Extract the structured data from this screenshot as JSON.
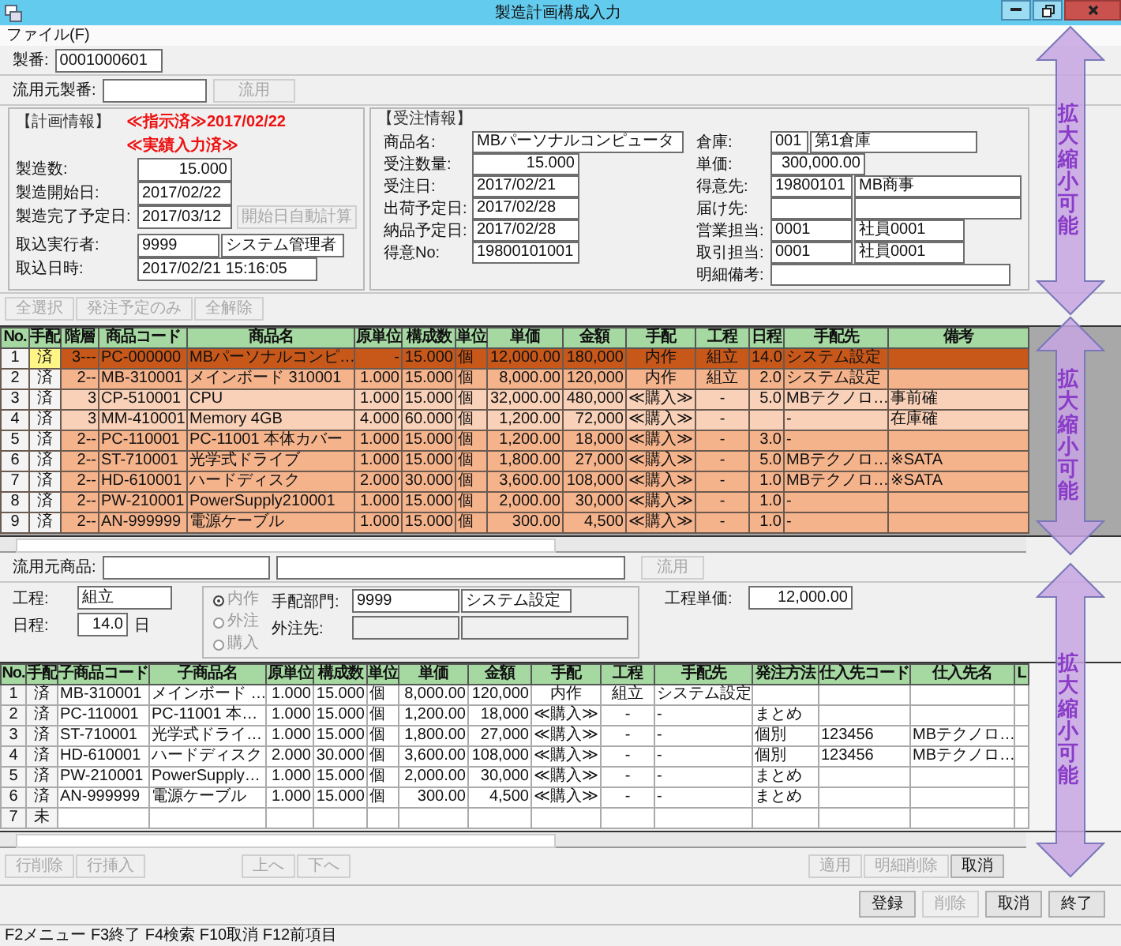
{
  "window": {
    "title": "製造計画構成入力"
  },
  "menu": [
    "ファイル(F)"
  ],
  "seiban": {
    "label": "製番:",
    "value": "0001000601"
  },
  "source_seiban": {
    "label": "流用元製番:",
    "button": {
      "label": "流用",
      "disabled": true
    }
  },
  "plan_info": {
    "title": "【計画情報】",
    "status_lines": [
      "≪指示済≫2017/02/22",
      "≪実績入力済≫"
    ],
    "fields": [
      {
        "label": "製造数:",
        "kind": "number",
        "values": [
          "15.000"
        ]
      },
      {
        "label": "製造開始日:",
        "kind": "text",
        "values": [
          "2017/02/22"
        ]
      },
      {
        "label": "製造完了予定日:",
        "kind": "text",
        "values": [
          "2017/03/12"
        ],
        "button": {
          "label": "開始日自動計算",
          "disabled": true
        }
      },
      {
        "label": "取込実行者:",
        "kind": "pair",
        "values": [
          "9999",
          "システム管理者"
        ]
      },
      {
        "label": "取込日時:",
        "kind": "wide",
        "values": [
          "2017/02/21 15:16:05"
        ]
      }
    ]
  },
  "order_info": {
    "title": "【受注情報】",
    "left": [
      {
        "label": "商品名:",
        "kind": "wide",
        "values": [
          "MBパーソナルコンピュータ"
        ]
      },
      {
        "label": "受注数量:",
        "kind": "number",
        "values": [
          "15.000"
        ]
      },
      {
        "label": "受注日:",
        "kind": "text",
        "values": [
          "2017/02/21"
        ]
      },
      {
        "label": "出荷予定日:",
        "kind": "text",
        "values": [
          "2017/02/28"
        ]
      },
      {
        "label": "納品予定日:",
        "kind": "text",
        "values": [
          "2017/02/28"
        ]
      },
      {
        "label": "得意No:",
        "kind": "text",
        "values": [
          "19800101001"
        ]
      }
    ],
    "right": [
      {
        "label": "倉庫:",
        "kind": "code",
        "values": [
          "001",
          "第1倉庫"
        ]
      },
      {
        "label": "単価:",
        "kind": "number",
        "values": [
          "300,000.00"
        ]
      },
      {
        "label": "得意先:",
        "kind": "pairwide",
        "values": [
          "19800101",
          "MB商事"
        ]
      },
      {
        "label": "届け先:",
        "kind": "pairwide"
      },
      {
        "label": "営業担当:",
        "kind": "pair",
        "values": [
          "0001",
          "社員0001"
        ]
      },
      {
        "label": "取引担当:",
        "kind": "pair",
        "values": [
          "0001",
          "社員0001"
        ]
      },
      {
        "label": "明細備考:",
        "kind": "wide"
      }
    ]
  },
  "selection_buttons": [
    {
      "label": "全選択",
      "disabled": true
    },
    {
      "label": "発注予定のみ",
      "disabled": true
    },
    {
      "label": "全解除",
      "disabled": true
    }
  ],
  "structure_table": {
    "columns": [
      {
        "label": "No.",
        "kind": "center"
      },
      {
        "label": "手配",
        "kind": "center"
      },
      {
        "label": "階層",
        "kind": "num"
      },
      {
        "label": "商品コード",
        "kind": "text"
      },
      {
        "label": "商品名",
        "kind": "text"
      },
      {
        "label": "原単位",
        "kind": "num"
      },
      {
        "label": "構成数",
        "kind": "num"
      },
      {
        "label": "単位",
        "kind": "text"
      },
      {
        "label": "単価",
        "kind": "num"
      },
      {
        "label": "金額",
        "kind": "num"
      },
      {
        "label": "手配",
        "kind": "center"
      },
      {
        "label": "工程",
        "kind": "center"
      },
      {
        "label": "日程",
        "kind": "num"
      },
      {
        "label": "手配先",
        "kind": "text"
      },
      {
        "label": "備考",
        "kind": "text"
      }
    ],
    "rows": [
      {
        "selected": true,
        "color": "#c8581a",
        "cells": [
          "1",
          "済",
          "3---",
          "PC-000000",
          "MBパーソナルコンピ…",
          "-",
          "15.000",
          "個",
          "12,000.00",
          "180,000",
          "内作",
          "組立",
          "14.0",
          "システム設定",
          null
        ]
      },
      {
        "selected": false,
        "color": "#f5b38c",
        "cells": [
          "2",
          "済",
          "2--",
          "MB-310001",
          "メインボード 310001",
          "1.000",
          "15.000",
          "個",
          "8,000.00",
          "120,000",
          "内作",
          "組立",
          "2.0",
          "システム設定",
          null
        ]
      },
      {
        "selected": false,
        "color": "#f9d1b8",
        "cells": [
          "3",
          "済",
          "3",
          "CP-510001",
          "CPU",
          "1.000",
          "15.000",
          "個",
          "32,000.00",
          "480,000",
          "≪購入≫",
          "-",
          "5.0",
          "MBテクノロ…",
          "事前確"
        ]
      },
      {
        "selected": false,
        "color": "#f9d1b8",
        "cells": [
          "4",
          "済",
          "3",
          "MM-410001",
          "Memory 4GB",
          "4.000",
          "60.000",
          "個",
          "1,200.00",
          "72,000",
          "≪購入≫",
          "-",
          null,
          "-",
          "在庫確"
        ]
      },
      {
        "selected": false,
        "color": "#f5b38c",
        "cells": [
          "5",
          "済",
          "2--",
          "PC-110001",
          "PC-11001 本体カバー",
          "1.000",
          "15.000",
          "個",
          "1,200.00",
          "18,000",
          "≪購入≫",
          "-",
          "3.0",
          "-",
          null
        ]
      },
      {
        "selected": false,
        "color": "#f5b38c",
        "cells": [
          "6",
          "済",
          "2--",
          "ST-710001",
          "光学式ドライブ",
          "1.000",
          "15.000",
          "個",
          "1,800.00",
          "27,000",
          "≪購入≫",
          "-",
          "5.0",
          "MBテクノロ…",
          "※SATA"
        ]
      },
      {
        "selected": false,
        "color": "#f5b38c",
        "cells": [
          "7",
          "済",
          "2--",
          "HD-610001",
          "ハードディスク",
          "2.000",
          "30.000",
          "個",
          "3,600.00",
          "108,000",
          "≪購入≫",
          "-",
          "1.0",
          "MBテクノロ…",
          "※SATA"
        ]
      },
      {
        "selected": false,
        "color": "#f5b38c",
        "cells": [
          "8",
          "済",
          "2--",
          "PW-210001",
          "PowerSupply210001",
          "1.000",
          "15.000",
          "個",
          "2,000.00",
          "30,000",
          "≪購入≫",
          "-",
          "1.0",
          "-",
          null
        ]
      },
      {
        "selected": false,
        "color": "#f5b38c",
        "cells": [
          "9",
          "済",
          "2--",
          "AN-999999",
          "電源ケーブル",
          "1.000",
          "15.000",
          "個",
          "300.00",
          "4,500",
          "≪購入≫",
          "-",
          "1.0",
          "-",
          null
        ]
      }
    ]
  },
  "process_panel": {
    "source_item": {
      "label": "流用元商品:",
      "button": {
        "label": "流用",
        "disabled": true
      }
    },
    "process": {
      "label": "工程:",
      "value": "組立"
    },
    "schedule": {
      "label": "日程:",
      "value": "14.0",
      "unit": "日"
    },
    "arrangement": {
      "disabled": true,
      "options": [
        {
          "label": "内作",
          "selected": true
        },
        {
          "label": "外注",
          "selected": false
        },
        {
          "label": "購入",
          "selected": false
        }
      ]
    },
    "department": {
      "label": "手配部門:",
      "values": [
        "9999",
        "システム設定"
      ]
    },
    "subcontractor": {
      "label": "外注先:"
    },
    "process_price": {
      "label": "工程単価:",
      "value": "12,000.00"
    }
  },
  "components_table": {
    "columns": [
      {
        "label": "No.",
        "kind": "center"
      },
      {
        "label": "手配",
        "kind": "center"
      },
      {
        "label": "子商品コード",
        "kind": "text"
      },
      {
        "label": "子商品名",
        "kind": "text"
      },
      {
        "label": "原単位",
        "kind": "num"
      },
      {
        "label": "構成数",
        "kind": "num"
      },
      {
        "label": "単位",
        "kind": "text"
      },
      {
        "label": "単価",
        "kind": "num"
      },
      {
        "label": "金額",
        "kind": "num"
      },
      {
        "label": "手配",
        "kind": "center"
      },
      {
        "label": "工程",
        "kind": "center"
      },
      {
        "label": "手配先",
        "kind": "text"
      },
      {
        "label": "発注方法",
        "kind": "text"
      },
      {
        "label": "仕入先コード",
        "kind": "text"
      },
      {
        "label": "仕入先名",
        "kind": "text"
      },
      {
        "label": "L",
        "kind": "text"
      }
    ],
    "rows": [
      {
        "cells": [
          "1",
          "済",
          "MB-310001",
          "メインボード …",
          "1.000",
          "15.000",
          "個",
          "8,000.00",
          "120,000",
          "内作",
          "組立",
          "システム設定",
          null,
          null,
          null,
          null
        ]
      },
      {
        "cells": [
          "2",
          "済",
          "PC-110001",
          "PC-11001 本…",
          "1.000",
          "15.000",
          "個",
          "1,200.00",
          "18,000",
          "≪購入≫",
          "-",
          "-",
          "まとめ",
          null,
          null,
          null
        ]
      },
      {
        "cells": [
          "3",
          "済",
          "ST-710001",
          "光学式ドライ…",
          "1.000",
          "15.000",
          "個",
          "1,800.00",
          "27,000",
          "≪購入≫",
          "-",
          "-",
          "個別",
          "123456",
          "MBテクノロ…",
          null
        ]
      },
      {
        "cells": [
          "4",
          "済",
          "HD-610001",
          "ハードディスク",
          "2.000",
          "30.000",
          "個",
          "3,600.00",
          "108,000",
          "≪購入≫",
          "-",
          "-",
          "個別",
          "123456",
          "MBテクノロ…",
          null
        ]
      },
      {
        "cells": [
          "5",
          "済",
          "PW-210001",
          "PowerSupply…",
          "1.000",
          "15.000",
          "個",
          "2,000.00",
          "30,000",
          "≪購入≫",
          "-",
          "-",
          "まとめ",
          null,
          null,
          null
        ]
      },
      {
        "cells": [
          "6",
          "済",
          "AN-999999",
          "電源ケーブル",
          "1.000",
          "15.000",
          "個",
          "300.00",
          "4,500",
          "≪購入≫",
          "-",
          "-",
          "まとめ",
          null,
          null,
          null
        ]
      },
      {
        "cells": [
          "7",
          "未",
          null,
          null,
          null,
          null,
          null,
          null,
          null,
          null,
          null,
          null,
          null,
          null,
          null,
          null
        ]
      }
    ]
  },
  "row_buttons": [
    {
      "label": "行削除",
      "disabled": true
    },
    {
      "label": "行挿入",
      "disabled": true
    },
    {
      "label": "上へ",
      "disabled": true
    },
    {
      "label": "下へ",
      "disabled": true
    }
  ],
  "detail_buttons": [
    {
      "label": "適用",
      "disabled": true
    },
    {
      "label": "明細削除",
      "disabled": true
    },
    {
      "label": "取消",
      "disabled": false
    }
  ],
  "footer_buttons": [
    {
      "label": "登録",
      "disabled": false
    },
    {
      "label": "削除",
      "disabled": true
    },
    {
      "label": "取消",
      "disabled": false
    },
    {
      "label": "終了",
      "disabled": false
    }
  ],
  "status_bar": "F2メニュー F3終了 F4検索 F10取消 F12前項目",
  "annotations": [
    {
      "text": "拡大縮小可能"
    },
    {
      "text": "拡大縮小可能"
    },
    {
      "text": "拡大縮小可能"
    }
  ]
}
